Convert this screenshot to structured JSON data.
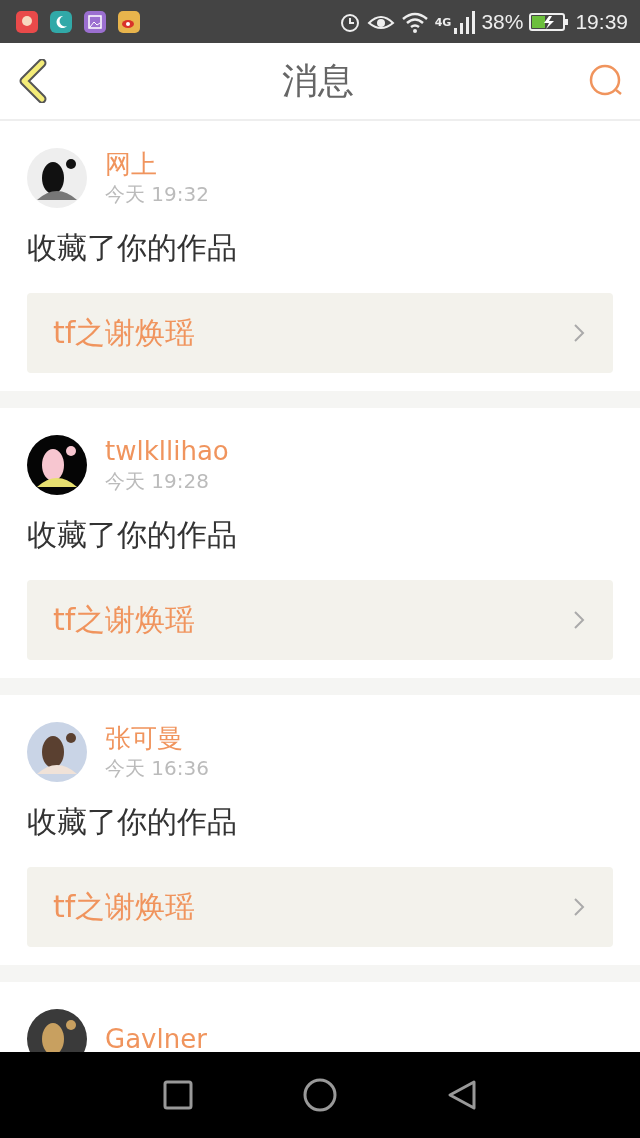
{
  "status_bar": {
    "network": "4G",
    "battery": "38%",
    "time": "19:39",
    "charging": true
  },
  "header": {
    "title": "消息"
  },
  "messages": [
    {
      "name": "网上",
      "time": "今天 19:32",
      "action": "收藏了你的作品",
      "work": "tf之谢焕瑶"
    },
    {
      "name": "twlkllihao",
      "time": "今天 19:28",
      "action": "收藏了你的作品",
      "work": "tf之谢焕瑶"
    },
    {
      "name": "张可曼",
      "time": "今天 16:36",
      "action": "收藏了你的作品",
      "work": "tf之谢焕瑶"
    },
    {
      "name": "Gavlner"
    }
  ]
}
